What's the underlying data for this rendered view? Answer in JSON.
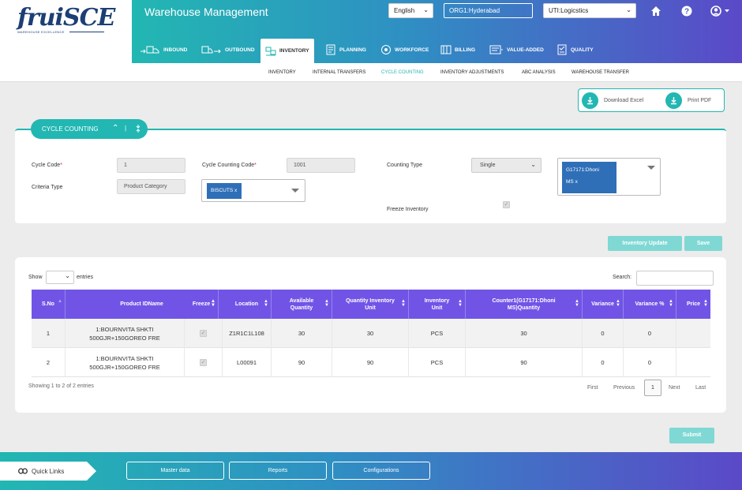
{
  "header": {
    "logo_text": "fruiSCE",
    "logo_sub": "WAREHOUSE EXCELLENCE",
    "app_title": "Warehouse Management",
    "language": "English",
    "org": "ORG1:Hyderabad",
    "company": "UTI:Logicstics",
    "home_icon": "home-icon",
    "help_icon": "help-icon",
    "user_icon": "user-icon"
  },
  "nav": {
    "items": [
      {
        "label": "INBOUND",
        "icon": "truck-in-icon"
      },
      {
        "label": "OUTBOUND",
        "icon": "truck-out-icon"
      },
      {
        "label": "INVENTORY",
        "icon": "inventory-icon"
      },
      {
        "label": "PLANNING",
        "icon": "planning-icon"
      },
      {
        "label": "WORKFORCE",
        "icon": "workforce-icon"
      },
      {
        "label": "BILLING",
        "icon": "billing-icon"
      },
      {
        "label": "VALUE-ADDED",
        "icon": "value-added-icon"
      },
      {
        "label": "QUALITY",
        "icon": "quality-icon"
      }
    ],
    "active": "INVENTORY"
  },
  "subnav": {
    "items": [
      "INVENTORY",
      "INTERNAL TRANSFERS",
      "CYCLE COUNTING",
      "INVENTORY ADJUSTMENTS",
      "ABC ANALYSIS",
      "WAREHOUSE TRANSFER"
    ],
    "active": "CYCLE COUNTING"
  },
  "export": {
    "download_excel": "Download Excel",
    "print_pdf": "Print PDF"
  },
  "section": {
    "title": "CYCLE COUNTING"
  },
  "form": {
    "cycle_code_label": "Cycle Code",
    "cycle_code_value": "1",
    "cycle_counting_code_label": "Cycle Counting Code",
    "cycle_counting_code_value": "1001",
    "counting_type_label": "Counting Type",
    "counting_type_value": "Single",
    "counter_chip": "G17171:Dhoni",
    "counter_chip_line2": "MS",
    "counter_chip_remove": "x",
    "criteria_type_label": "Criteria Type",
    "criteria_type_value": "Product Category",
    "category_chip": "BISCUTS",
    "category_chip_remove": "x",
    "freeze_inventory_label": "Freeze Inventory",
    "required_mark": "*"
  },
  "actions": {
    "inventory_update": "Inventory Update",
    "save": "Save",
    "submit": "Submit"
  },
  "table": {
    "show_label": "Show",
    "entries_label": "entries",
    "search_label": "Search:",
    "columns": [
      "S.No",
      "Product IDName",
      "Freeze",
      "Location",
      "Available Quantity",
      "Quantity Inventory Unit",
      "Inventory Unit",
      "Counter1(G17171:Dhoni MS)Quantity",
      "Variance",
      "Variance %",
      "Price"
    ],
    "rows": [
      {
        "sno": "1",
        "product": "1:BOURNVITA SHKTI 500GJR+150GOREO FRE",
        "location": "Z1R1C1L108",
        "available": "30",
        "qty_inv_unit": "30",
        "unit": "PCS",
        "counter_qty": "30",
        "variance": "0",
        "variance_pct": "0",
        "price": ""
      },
      {
        "sno": "2",
        "product": "1:BOURNVITA SHKTI 500GJR+150GOREO FRE",
        "location": "L00091",
        "available": "90",
        "qty_inv_unit": "90",
        "unit": "PCS",
        "counter_qty": "90",
        "variance": "0",
        "variance_pct": "0",
        "price": ""
      }
    ],
    "info": "Showing 1 to 2 of 2 entries",
    "pager": {
      "first": "First",
      "previous": "Previous",
      "page": "1",
      "next": "Next",
      "last": "Last"
    }
  },
  "footer": {
    "quick_links": "Quick Links",
    "buttons": [
      "Master data",
      "Reports",
      "Configurations"
    ]
  },
  "colors": {
    "teal": "#22b7b2",
    "purple": "#5b49c8",
    "table_header": "#7154e6",
    "chip_blue": "#2f6fb8",
    "logo_navy": "#1c3f74"
  }
}
